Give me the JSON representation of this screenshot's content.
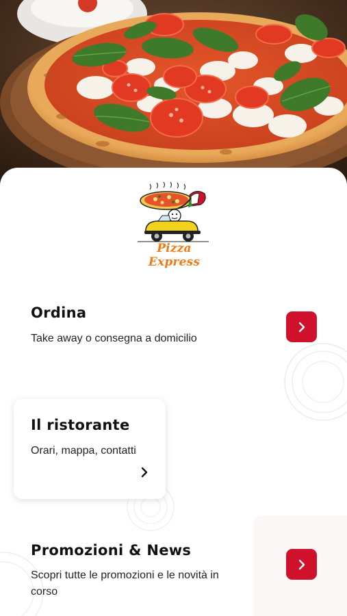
{
  "brand": {
    "logo_text": "Pizza Express",
    "accent_color": "#d0112b",
    "logo_text_color": "#f07a12"
  },
  "hero": {
    "icon": "pizza-photo"
  },
  "sections": {
    "ordina": {
      "title": "Ordina",
      "subtitle": "Take away o consegna a domicilio",
      "icon": "chevron-right-icon"
    },
    "ristorante": {
      "title": "Il ristorante",
      "subtitle": "Orari, mappa, contatti",
      "icon": "chevron-right-icon"
    },
    "promozioni": {
      "title": "Promozioni & News",
      "subtitle_line1": "Scopri tutte le promozioni e le novità in",
      "subtitle_line2": "corso",
      "icon": "chevron-right-icon"
    }
  }
}
